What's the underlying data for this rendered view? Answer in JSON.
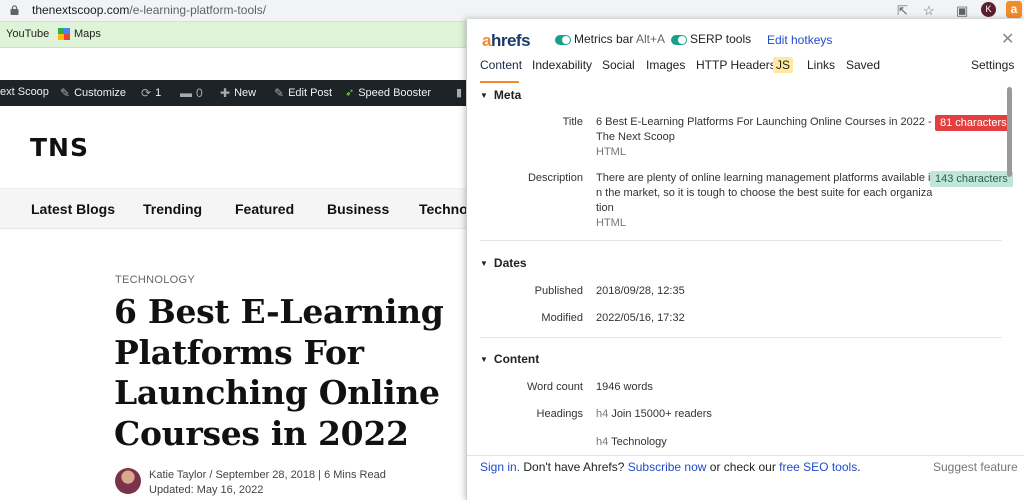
{
  "browser": {
    "url_main": "thenextscoop.com",
    "url_path": "/e-learning-platform-tools/",
    "avatar_letter": "K",
    "ext_letter": "a"
  },
  "bookmarks": [
    {
      "label": "YouTube"
    },
    {
      "label": "Maps"
    }
  ],
  "wpbar": {
    "site": "ext Scoop",
    "customize": "Customize",
    "updates": "1",
    "comments": "0",
    "new": "New",
    "edit_post": "Edit Post",
    "speed": "Speed Booster"
  },
  "site": {
    "logo": "TNS",
    "nav": [
      "Latest Blogs",
      "Trending",
      "Featured",
      "Business",
      "Technol"
    ],
    "category": "TECHNOLOGY",
    "headline": "6 Best E-Learning Platforms For Launching Online Courses in 2022",
    "byline_line1": "Katie Taylor / September 28, 2018 | 6 Mins Read",
    "byline_line2": "Updated: May 16, 2022"
  },
  "ahrefs": {
    "brand_a": "a",
    "brand_rest": "hrefs",
    "metrics_label": "Metrics bar",
    "metrics_hotkey": "Alt+A",
    "serp_label": "SERP tools",
    "edit_hotkeys": "Edit hotkeys",
    "tabs": [
      "Content",
      "Indexability",
      "Social",
      "Images",
      "HTTP Headers",
      "JS",
      "Links",
      "Saved"
    ],
    "settings": "Settings",
    "meta": {
      "heading": "Meta",
      "title_label": "Title",
      "title_line1": "6 Best E-Learning Platforms For Launching Online Courses in 2022 -",
      "title_line2": "The Next Scoop",
      "title_type": "HTML",
      "title_badge": "81 characters",
      "desc_label": "Description",
      "desc_line1": "There are plenty of online learning management platforms available i",
      "desc_line2": "n the market, so it is tough to choose the best suite for each organiza",
      "desc_line3": "tion",
      "desc_type": "HTML",
      "desc_badge": "143 characters"
    },
    "dates": {
      "heading": "Dates",
      "published_label": "Published",
      "published_value": "2018/09/28, 12:35",
      "modified_label": "Modified",
      "modified_value": "2022/05/16, 17:32"
    },
    "content": {
      "heading": "Content",
      "wordcount_label": "Word count",
      "wordcount_value": "1946 words",
      "headings_label": "Headings",
      "heading1_tag": "h4",
      "heading1_text": "Join 15000+ readers",
      "heading2_tag": "h4",
      "heading2_text": "Technology"
    },
    "footer": {
      "signin": "Sign in.",
      "mid1": " Don't have Ahrefs? ",
      "subscribe": "Subscribe now",
      "mid2": " or check our ",
      "seo_tools": "free SEO tools",
      "end": ".",
      "suggest": "Suggest feature"
    }
  },
  "colors": {
    "ahrefs_orange": "#f28b2c",
    "toggle_green": "#19a08a",
    "badge_red": "#e43f3f",
    "badge_green": "#bfe6d8",
    "teal_block": "#1aa58e"
  }
}
